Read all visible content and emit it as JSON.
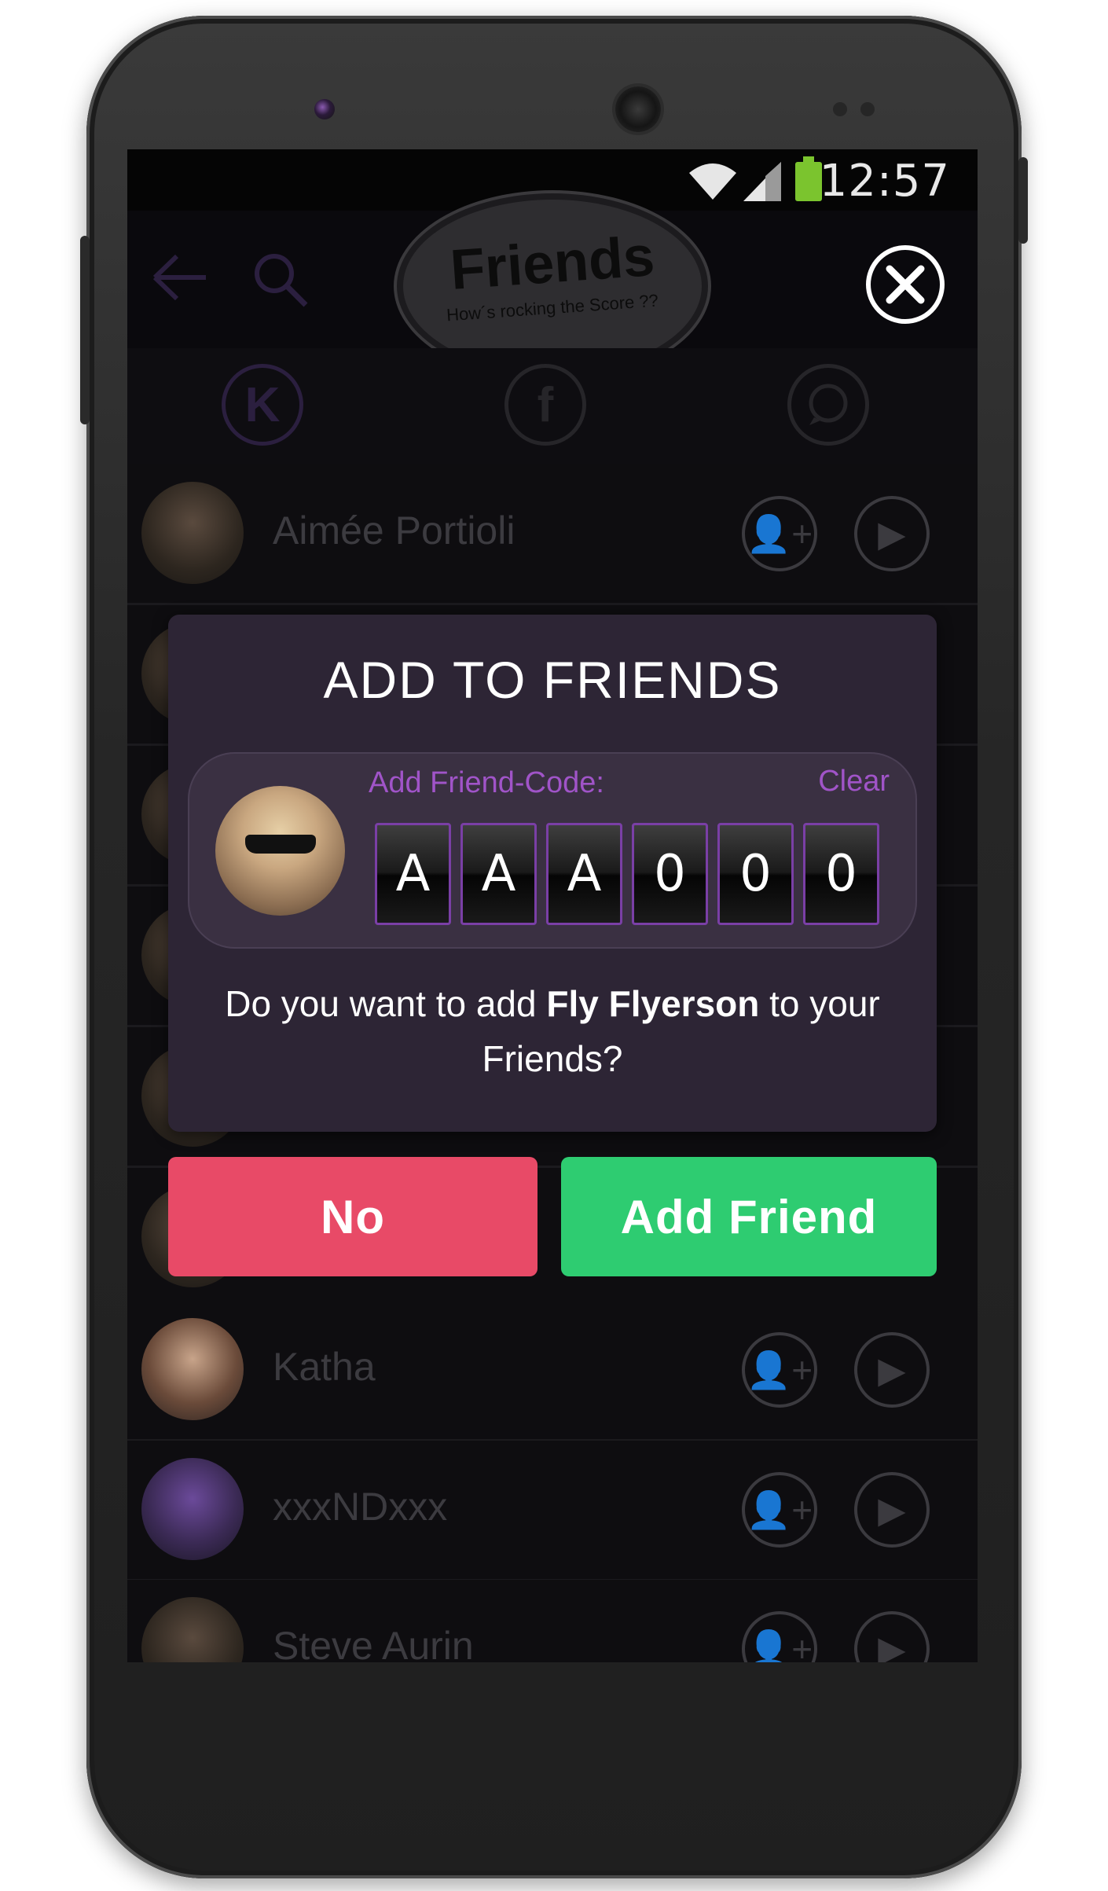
{
  "status_bar": {
    "time": "12:57"
  },
  "header": {
    "title": "Friends",
    "subtitle": "How´s rocking the Score ??"
  },
  "tabs": {
    "app_icon_letter": "K",
    "facebook_icon_letter": "f"
  },
  "friends_list": [
    {
      "name": "Aimée Portioli"
    },
    {
      "name": "Katha"
    },
    {
      "name": "xxxNDxxx"
    },
    {
      "name": "Steve Aurin"
    }
  ],
  "dialog": {
    "title": "ADD TO FRIENDS",
    "code_label": "Add Friend-Code:",
    "clear_label": "Clear",
    "code_chars": [
      "A",
      "A",
      "A",
      "0",
      "0",
      "0"
    ],
    "message_prefix": "Do you want to add ",
    "friend_name": "Fly Flyerson",
    "message_suffix": " to your Friends?"
  },
  "buttons": {
    "no_label": "No",
    "add_label": "Add Friend"
  },
  "colors": {
    "accent_purple": "#a054c8",
    "no_button": "#e84a67",
    "add_button": "#2ecc71",
    "dialog_bg": "#2d2535"
  }
}
